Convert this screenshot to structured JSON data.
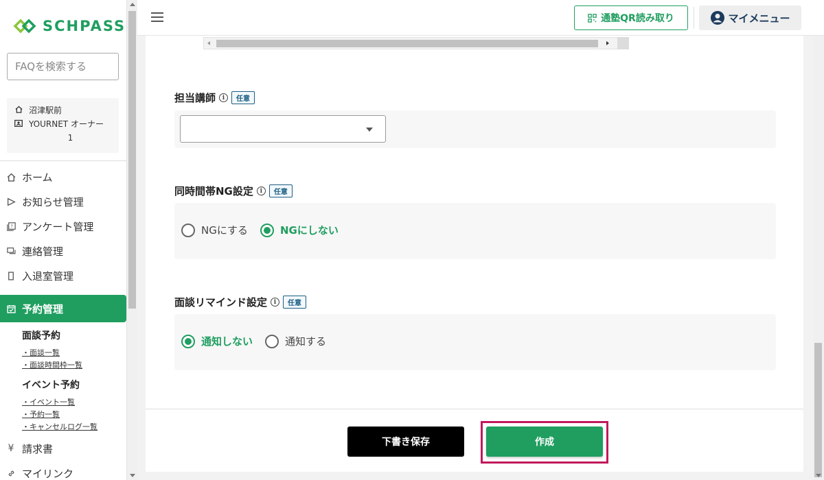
{
  "brand": {
    "name": "SCHPASS",
    "accent": "#1f9e60"
  },
  "sidebar": {
    "search_placeholder": "FAQを検索する",
    "school": {
      "name": "沼津駅前",
      "owner_line1": "YOURNET オーナー",
      "owner_line2": "1"
    },
    "nav": [
      {
        "label": "ホーム",
        "icon": "home-icon"
      },
      {
        "label": "お知らせ管理",
        "icon": "send-icon"
      },
      {
        "label": "アンケート管理",
        "icon": "survey-icon"
      },
      {
        "label": "連絡管理",
        "icon": "chat-icon"
      },
      {
        "label": "入退室管理",
        "icon": "door-icon"
      }
    ],
    "active": {
      "label": "予約管理",
      "icon": "calendar-check-icon"
    },
    "sub": {
      "interview_head": "面談予約",
      "interview_links": [
        "・面談一覧",
        "・面談時間枠一覧"
      ],
      "event_head": "イベント予約",
      "event_links": [
        "・イベント一覧",
        "・予約一覧",
        "・キャンセルログ一覧"
      ]
    },
    "nav_after": [
      {
        "label": "請求書",
        "icon": "yen-icon"
      },
      {
        "label": "マイリンク",
        "icon": "link-icon"
      }
    ]
  },
  "header": {
    "qr_label": "通塾QR読み取り",
    "mymenu_label": "マイメニュー"
  },
  "form": {
    "teacher": {
      "label": "担当講師",
      "badge": "任意",
      "value": ""
    },
    "ng": {
      "label": "同時間帯NG設定",
      "badge": "任意",
      "options": [
        {
          "label": "NGにする",
          "checked": false
        },
        {
          "label": "NGにしない",
          "checked": true
        }
      ]
    },
    "remind": {
      "label": "面談リマインド設定",
      "badge": "任意",
      "options": [
        {
          "label": "通知しない",
          "checked": true
        },
        {
          "label": "通知する",
          "checked": false
        }
      ]
    }
  },
  "footer": {
    "draft_label": "下書き保存",
    "create_label": "作成"
  }
}
